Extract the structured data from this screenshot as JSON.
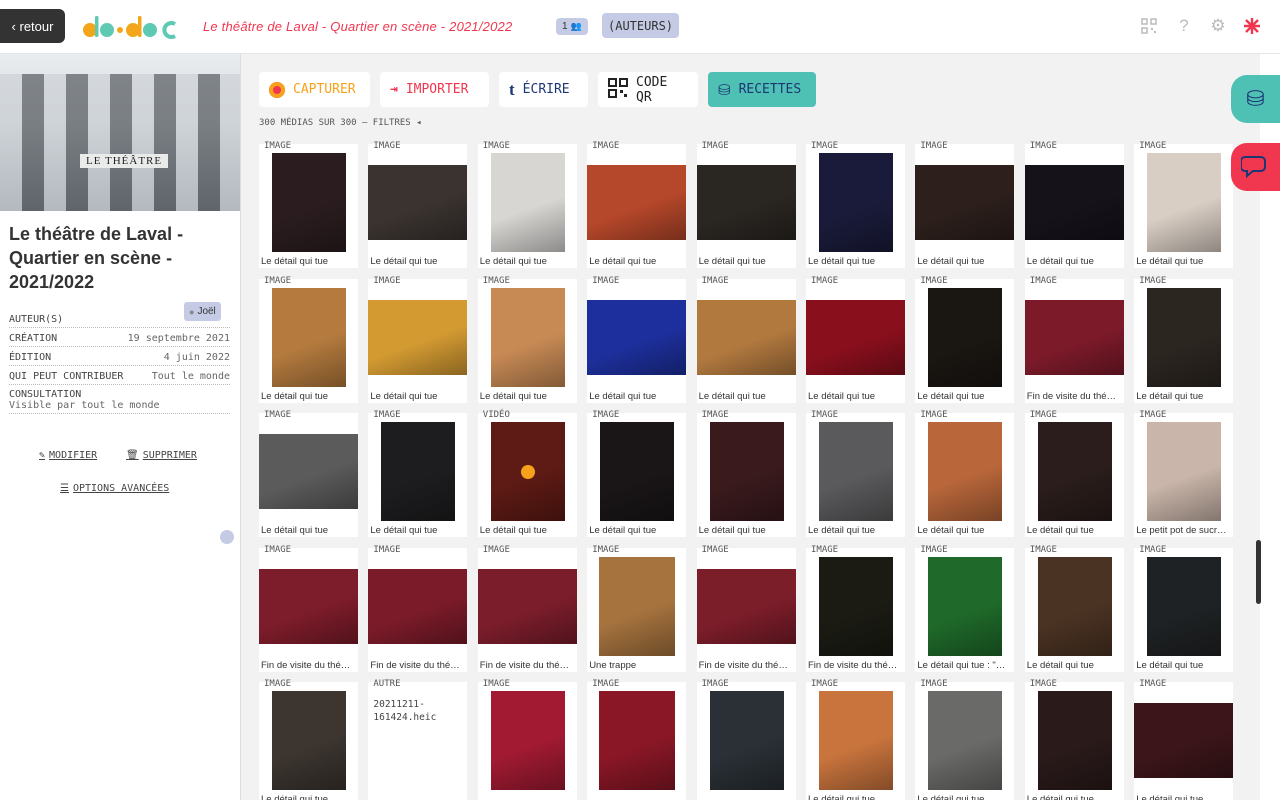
{
  "topbar": {
    "back_label": "‹ retour",
    "logo_text": "do•doc",
    "project_title": "Le théâtre de Laval - Quartier en scène - 2021/2022",
    "user_count": "1",
    "group_label": "(AUTEURS)",
    "icons": [
      "qr-icon",
      "help-icon",
      "settings-icon",
      "lang-icon"
    ]
  },
  "sidebar": {
    "cover_sign": "LE THÉÂTRE",
    "title": "Le théâtre de Laval - Quartier en scène - 2021/2022",
    "author_chip": "Joël",
    "meta": [
      {
        "label": "AUTEUR(S)",
        "value": ""
      },
      {
        "label": "CRÉATION",
        "value": "19 septembre 2021"
      },
      {
        "label": "ÉDITION",
        "value": "4 juin 2022"
      },
      {
        "label": "QUI PEUT CONTRIBUER",
        "value": "Tout le monde"
      }
    ],
    "consultation_label": "CONSULTATION",
    "consultation_value": "Visible par tout le monde",
    "modify_label": "MODIFIER",
    "delete_label": "SUPPRIMER",
    "advanced_label": "OPTIONS AVANCÉES"
  },
  "toolbar": {
    "capture": "CAPTURER",
    "import": "IMPORTER",
    "write": "ÉCRIRE",
    "qr": "CODE QR",
    "recipes": "RECETTES",
    "write_glyph": "t"
  },
  "filter_line": "300 MÉDIAS SUR 300 — FILTRES ◂",
  "media": [
    {
      "type": "IMAGE",
      "caption": "Le détail qui tue",
      "color": "#2b1d1f",
      "shape": "portrait"
    },
    {
      "type": "IMAGE",
      "caption": "Le détail qui tue",
      "color": "#3a3330",
      "shape": "landscape"
    },
    {
      "type": "IMAGE",
      "caption": "Le détail qui tue",
      "color": "#d8d6d3",
      "shape": "portrait"
    },
    {
      "type": "IMAGE",
      "caption": "Le détail qui tue",
      "color": "#b5472a",
      "shape": "landscape"
    },
    {
      "type": "IMAGE",
      "caption": "Le détail qui tue",
      "color": "#2a2622",
      "shape": "landscape"
    },
    {
      "type": "IMAGE",
      "caption": "Le détail qui tue",
      "color": "#1a1b3a",
      "shape": "portrait"
    },
    {
      "type": "IMAGE",
      "caption": "Le détail qui tue",
      "color": "#2c1f1c",
      "shape": "landscape"
    },
    {
      "type": "IMAGE",
      "caption": "Le détail qui tue",
      "color": "#15121a",
      "shape": "landscape"
    },
    {
      "type": "IMAGE",
      "caption": "Le détail qui tue",
      "color": "#d9cec4",
      "shape": "portrait"
    },
    {
      "type": "IMAGE",
      "caption": "Le détail qui tue",
      "color": "#b57b3e",
      "shape": "portrait"
    },
    {
      "type": "IMAGE",
      "caption": "Le détail qui tue",
      "color": "#d39a32",
      "shape": "landscape"
    },
    {
      "type": "IMAGE",
      "caption": "Le détail qui tue",
      "color": "#c88a55",
      "shape": "portrait"
    },
    {
      "type": "IMAGE",
      "caption": "Le détail qui tue",
      "color": "#1d2f9c",
      "shape": "landscape"
    },
    {
      "type": "IMAGE",
      "caption": "Le détail qui tue",
      "color": "#b2793f",
      "shape": "landscape"
    },
    {
      "type": "IMAGE",
      "caption": "Le détail qui tue",
      "color": "#8a0f1d",
      "shape": "landscape"
    },
    {
      "type": "IMAGE",
      "caption": "Le détail qui tue",
      "color": "#1a1612",
      "shape": "portrait"
    },
    {
      "type": "IMAGE",
      "caption": "Fin de visite du thé…",
      "color": "#7d1a2a",
      "shape": "landscape"
    },
    {
      "type": "IMAGE",
      "caption": "Le détail qui tue",
      "color": "#2c2621",
      "shape": "portrait"
    },
    {
      "type": "IMAGE",
      "caption": "Le détail qui tue",
      "color": "#5b5b5b",
      "shape": "landscape"
    },
    {
      "type": "IMAGE",
      "caption": "Le détail qui tue",
      "color": "#1d1d1f",
      "shape": "portrait"
    },
    {
      "type": "VIDÉO",
      "caption": "Le détail qui tue",
      "color": "#5e1a14",
      "shape": "portrait"
    },
    {
      "type": "IMAGE",
      "caption": "Le détail qui tue",
      "color": "#1a1617",
      "shape": "portrait"
    },
    {
      "type": "IMAGE",
      "caption": "Le détail qui tue",
      "color": "#3a1a1d",
      "shape": "portrait"
    },
    {
      "type": "IMAGE",
      "caption": "Le détail qui tue",
      "color": "#5a5a5c",
      "shape": "portrait"
    },
    {
      "type": "IMAGE",
      "caption": "Le détail qui tue",
      "color": "#b8663a",
      "shape": "portrait"
    },
    {
      "type": "IMAGE",
      "caption": "Le détail qui tue",
      "color": "#2a1d1b",
      "shape": "portrait"
    },
    {
      "type": "IMAGE",
      "caption": "Le petit pot de sucr…",
      "color": "#c9b5a9",
      "shape": "portrait"
    },
    {
      "type": "IMAGE",
      "caption": "Fin de visite du thé…",
      "color": "#7d1c2a",
      "shape": "landscape"
    },
    {
      "type": "IMAGE",
      "caption": "Fin de visite du thé…",
      "color": "#7b1b29",
      "shape": "landscape"
    },
    {
      "type": "IMAGE",
      "caption": "Fin de visite du thé…",
      "color": "#7b1d2b",
      "shape": "landscape"
    },
    {
      "type": "IMAGE",
      "caption": "Une trappe",
      "color": "#a6733e",
      "shape": "landscape-tall"
    },
    {
      "type": "IMAGE",
      "caption": "Fin de visite du thé…",
      "color": "#7c1d2a",
      "shape": "landscape"
    },
    {
      "type": "IMAGE",
      "caption": "Fin de visite du thé…",
      "color": "#1b1b14",
      "shape": "portrait"
    },
    {
      "type": "IMAGE",
      "caption": "Le détail qui tue : \"…",
      "color": "#1f6a2a",
      "shape": "portrait"
    },
    {
      "type": "IMAGE",
      "caption": "Le détail qui tue",
      "color": "#4b3323",
      "shape": "portrait"
    },
    {
      "type": "IMAGE",
      "caption": "Le détail qui tue",
      "color": "#1f2224",
      "shape": "portrait"
    },
    {
      "type": "IMAGE",
      "caption": "Le détail qui tue",
      "color": "#3c3530",
      "shape": "portrait"
    },
    {
      "type": "AUTRE",
      "caption": "",
      "color": "#ffffff",
      "shape": "text",
      "text": "20211211-161424.heic"
    },
    {
      "type": "IMAGE",
      "caption": "",
      "color": "#a11a32",
      "shape": "portrait"
    },
    {
      "type": "IMAGE",
      "caption": "",
      "color": "#8a1726",
      "shape": "landscape-tall"
    },
    {
      "type": "IMAGE",
      "caption": "",
      "color": "#2a3036",
      "shape": "portrait"
    },
    {
      "type": "IMAGE",
      "caption": "Le détail qui tue",
      "color": "#c9743d",
      "shape": "portrait"
    },
    {
      "type": "IMAGE",
      "caption": "Le détail qui tue",
      "color": "#6a6a68",
      "shape": "portrait"
    },
    {
      "type": "IMAGE",
      "caption": "Le détail qui tue",
      "color": "#2a1a1a",
      "shape": "portrait"
    },
    {
      "type": "IMAGE",
      "caption": "Le détail qui tue",
      "color": "#3b1519",
      "shape": "landscape"
    }
  ]
}
